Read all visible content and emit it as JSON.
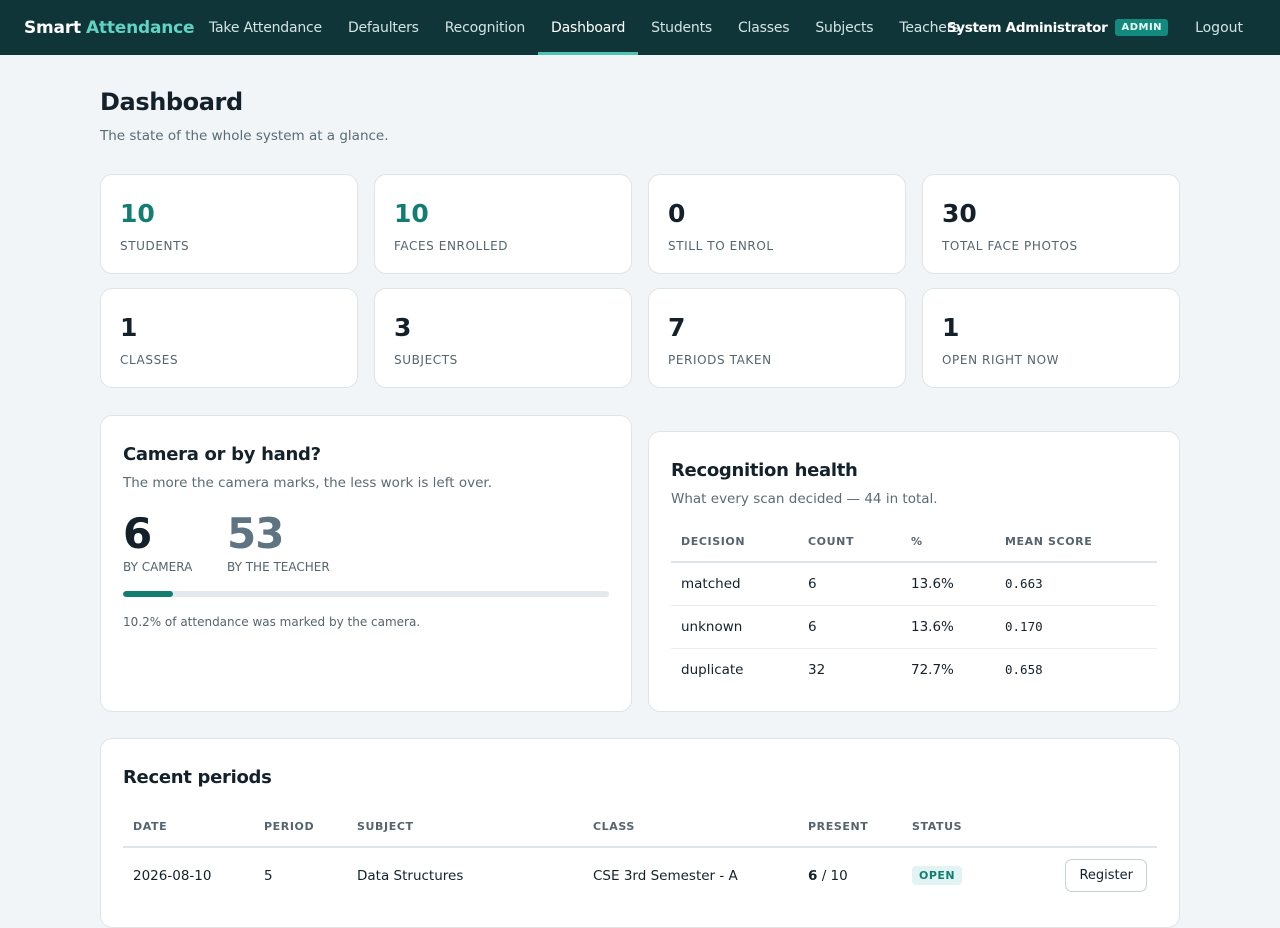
{
  "brand": {
    "name": "Smart",
    "accent": "Attendance"
  },
  "nav": {
    "items": [
      {
        "label": "Take Attendance"
      },
      {
        "label": "Defaulters"
      },
      {
        "label": "Recognition"
      },
      {
        "label": "Dashboard",
        "active": true
      },
      {
        "label": "Students"
      },
      {
        "label": "Classes"
      },
      {
        "label": "Subjects"
      },
      {
        "label": "Teachers"
      }
    ],
    "user": "System Administrator",
    "role": "ADMIN",
    "logout": "Logout"
  },
  "header": {
    "title": "Dashboard",
    "subtitle": "The state of the whole system at a glance."
  },
  "stats": [
    {
      "value": "10",
      "label": "STUDENTS"
    },
    {
      "value": "10",
      "label": "FACES ENROLLED"
    },
    {
      "value": "0",
      "label": "STILL TO ENROL"
    },
    {
      "value": "30",
      "label": "TOTAL FACE PHOTOS"
    },
    {
      "value": "1",
      "label": "CLASSES"
    },
    {
      "value": "3",
      "label": "SUBJECTS"
    },
    {
      "value": "7",
      "label": "PERIODS TAKEN"
    },
    {
      "value": "1",
      "label": "OPEN RIGHT NOW"
    }
  ],
  "camera_panel": {
    "title": "Camera or by hand?",
    "subtitle": "The more the camera marks, the less work is left over.",
    "camera_count": "6",
    "camera_label": "BY CAMERA",
    "teacher_count": "53",
    "teacher_label": "BY THE TEACHER",
    "camera_fraction": 0.102,
    "note": "10.2% of attendance was marked by the camera."
  },
  "recognition_panel": {
    "title": "Recognition health",
    "subtitle": "What every scan decided — 44 in total.",
    "columns": [
      "DECISION",
      "COUNT",
      "%",
      "MEAN SCORE"
    ],
    "rows": [
      {
        "decision": "matched",
        "count": "6",
        "pct": "13.6%",
        "score": "0.663"
      },
      {
        "decision": "unknown",
        "count": "6",
        "pct": "13.6%",
        "score": "0.170"
      },
      {
        "decision": "duplicate",
        "count": "32",
        "pct": "72.7%",
        "score": "0.658"
      }
    ]
  },
  "recent_panel": {
    "title": "Recent periods",
    "columns": [
      "DATE",
      "PERIOD",
      "SUBJECT",
      "CLASS",
      "PRESENT",
      "STATUS"
    ],
    "rows": [
      {
        "date": "2026-08-10",
        "period": "5",
        "subject": "Data Structures",
        "class": "CSE 3rd Semester - A",
        "present": "6",
        "total": "/ 10",
        "status": "OPEN",
        "action": "Register"
      }
    ]
  },
  "colors": {
    "navbar": "#0f3538",
    "accent": "#5fd3c4",
    "teal": "#137d72",
    "background": "#f1f5f7"
  }
}
